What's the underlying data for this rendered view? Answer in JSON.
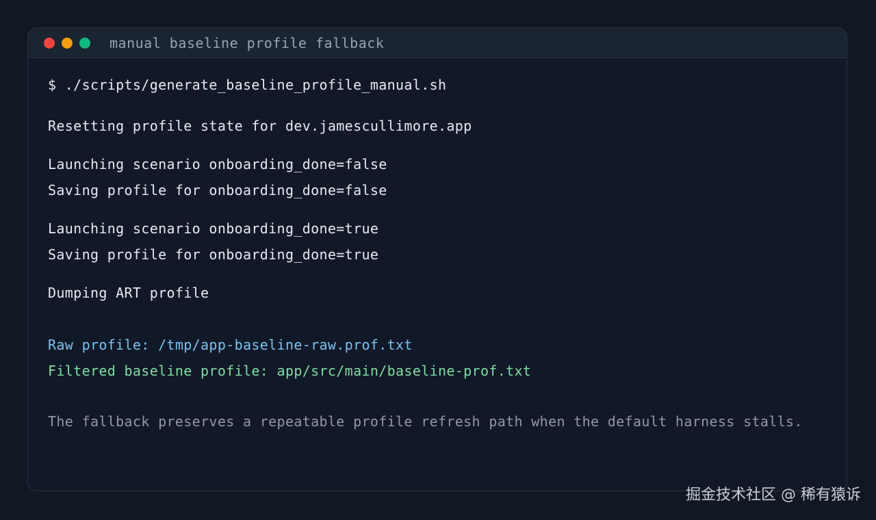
{
  "window": {
    "title": "manual baseline profile fallback",
    "controls": {
      "close_color": "#ef4444",
      "minimize_color": "#f59e0b",
      "maximize_color": "#10b981"
    }
  },
  "terminal": {
    "lines": [
      {
        "text": "$ ./scripts/generate_baseline_profile_manual.sh",
        "tone": "default"
      },
      {
        "text": "Resetting profile state for dev.jamescullimore.app",
        "tone": "default"
      },
      {
        "text": "Launching scenario onboarding_done=false",
        "tone": "default"
      },
      {
        "text": "Saving profile for onboarding_done=false",
        "tone": "default"
      },
      {
        "text": "Launching scenario onboarding_done=true",
        "tone": "default"
      },
      {
        "text": "Saving profile for onboarding_done=true",
        "tone": "default"
      },
      {
        "text": "Dumping ART profile",
        "tone": "default"
      },
      {
        "text": "Raw profile: /tmp/app-baseline-raw.prof.txt",
        "tone": "blue"
      },
      {
        "text": "Filtered baseline profile: app/src/main/baseline-prof.txt",
        "tone": "green"
      },
      {
        "text": "The fallback preserves a repeatable profile refresh path when the default harness stalls.",
        "tone": "muted"
      }
    ]
  },
  "watermark": "掘金技术社区 @ 稀有猿诉"
}
